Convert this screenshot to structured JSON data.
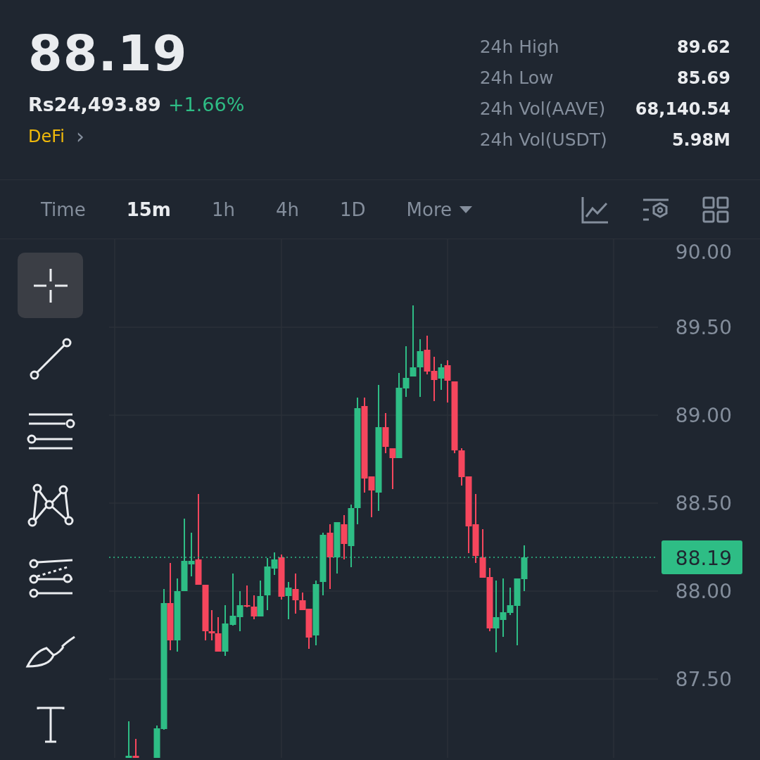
{
  "ticker": {
    "price": "88.19",
    "fiat_price": "Rs24,493.89",
    "change": "+1.66%",
    "category": "DeFi",
    "category_arrow": "›"
  },
  "stats": [
    {
      "label": "24h High",
      "value": "89.62"
    },
    {
      "label": "24h Low",
      "value": "85.69"
    },
    {
      "label": "24h Vol(AAVE)",
      "value": "68,140.54"
    },
    {
      "label": "24h Vol(USDT)",
      "value": "5.98M"
    }
  ],
  "intervals": [
    {
      "label": "Time",
      "selected": false
    },
    {
      "label": "15m",
      "selected": true
    },
    {
      "label": "1h",
      "selected": false
    },
    {
      "label": "4h",
      "selected": false
    },
    {
      "label": "1D",
      "selected": false
    },
    {
      "label": "More",
      "selected": false
    }
  ],
  "chart_tools": [
    {
      "kind": "crosshair",
      "selected": true
    },
    {
      "kind": "trend-line",
      "selected": false
    },
    {
      "kind": "horizontal-lines",
      "selected": false
    },
    {
      "kind": "pattern",
      "selected": false
    },
    {
      "kind": "parallel-channel",
      "selected": false
    },
    {
      "kind": "brush",
      "selected": false
    },
    {
      "kind": "text",
      "selected": false
    }
  ],
  "price_axis": [
    "90.00",
    "89.50",
    "89.00",
    "88.50",
    "88.00",
    "87.50"
  ],
  "last_price_tag": "88.19"
}
